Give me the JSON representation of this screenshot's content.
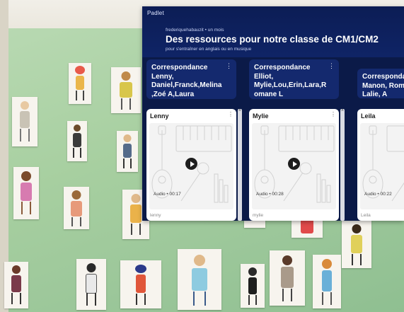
{
  "padlet": {
    "brand": "Padlet",
    "meta": "frederiquehabauzit • un mois",
    "title": "Des ressources pour notre classe de CM1/CM2",
    "subtitle": "pour s'entraîner en anglais ou en musique"
  },
  "columns": [
    {
      "header": "Correspondance Lenny, Daniel,Franck,Melina ,Zoé A,Laura",
      "card": {
        "title": "Lenny",
        "audio_label": "Audio • 00:17",
        "author": "lenny"
      }
    },
    {
      "header": "Correspondance Elliot, Mylie,Lou,Erin,Lara,R omane L",
      "card": {
        "title": "Mylie",
        "audio_label": "Audio • 00:28",
        "author": "mylie"
      }
    },
    {
      "header": "Correspondance Manon, Rom Leila, Lalie, A",
      "card": {
        "title": "Leila",
        "audio_label": "Audio • 00:22",
        "author": "Leila"
      }
    }
  ],
  "icons": {
    "menu": "⋮",
    "play": "play-icon"
  },
  "colors": {
    "padlet_bg": "#0b1a48",
    "column_header": "#14296e",
    "wall": "#a7cfa0"
  }
}
